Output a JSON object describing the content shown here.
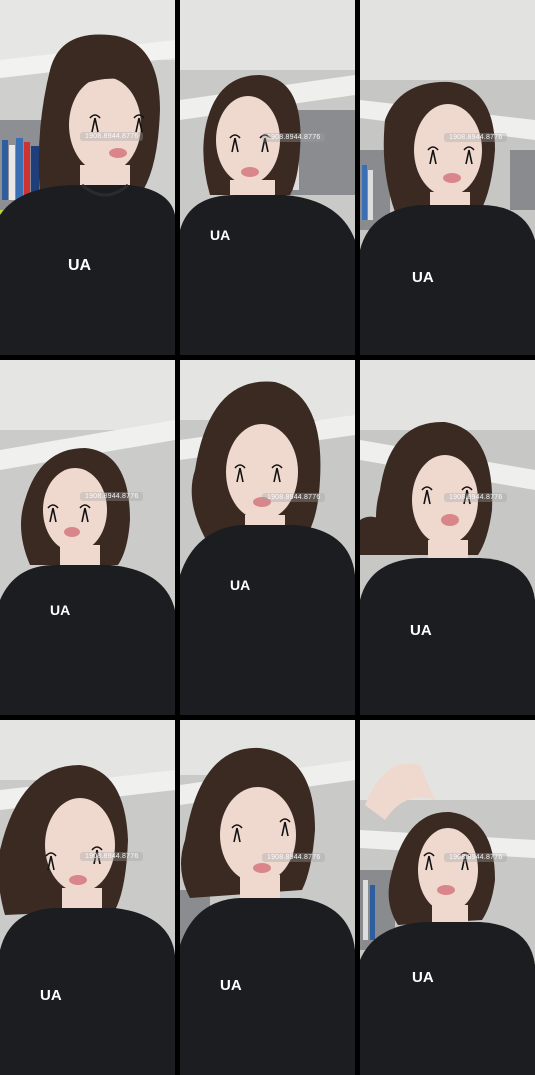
{
  "grid": {
    "rows": 3,
    "columns": 3,
    "background_color": "#000000"
  },
  "frames": [
    {
      "watermark": "1908.8944.8776"
    },
    {
      "watermark": "1908.8944.8776"
    },
    {
      "watermark": "1908.8944.8776"
    },
    {
      "watermark": "1908.8944.8776"
    },
    {
      "watermark": "1908.8944.8776"
    },
    {
      "watermark": "1908.8944.8776"
    },
    {
      "watermark": "1908.8944.8776"
    },
    {
      "watermark": "1908.8944.8776"
    },
    {
      "watermark": "1908.8944.8776"
    }
  ],
  "colors": {
    "wall": "#c9c9c7",
    "ceiling": "#e4e4e2",
    "shirt": "#1c1d20",
    "hair": "#3a2a22",
    "skin": "#efd9cf",
    "chair": "#b7d63c"
  }
}
